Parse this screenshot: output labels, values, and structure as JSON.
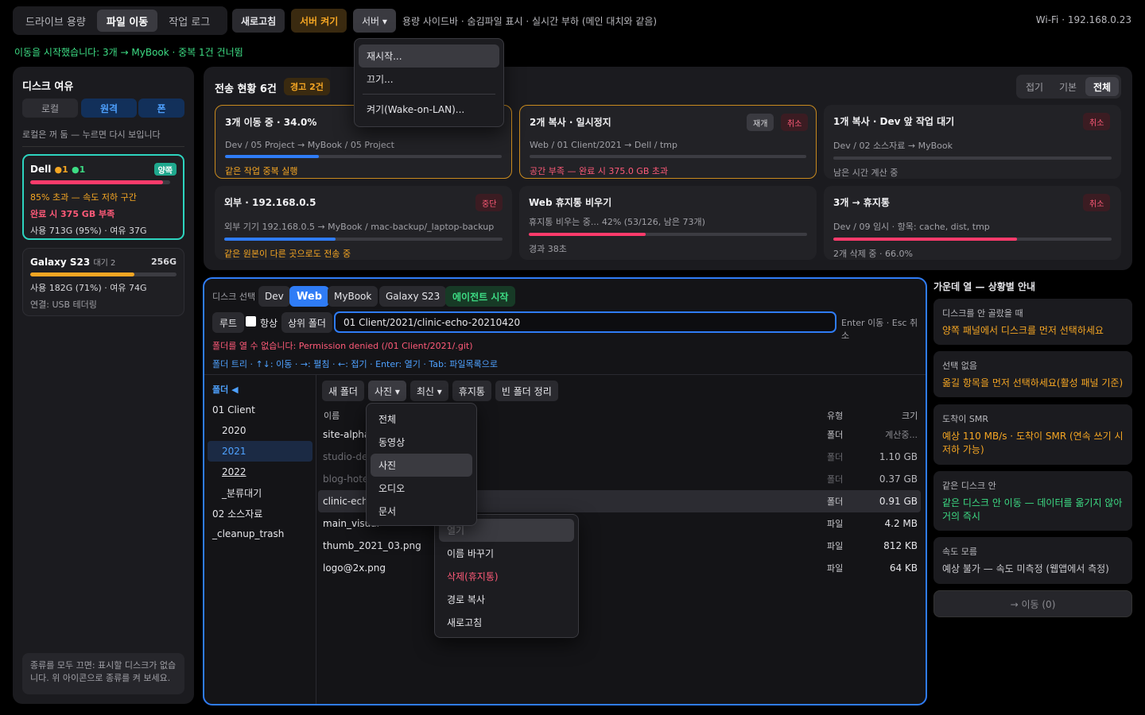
{
  "top": {
    "tabs": [
      "드라이브 용량",
      "파일 이동",
      "작업 로그"
    ],
    "refresh": "새로고침",
    "server_on": "서버 켜기",
    "server": "서버 ▾",
    "info": "용량 사이드바 · 숨김파일 표시 · 실시간 부하 (메인 대치와 같음)",
    "wifi": "Wi-Fi · 192.168.0.23",
    "status": "이동을 시작했습니다: 3개 → MyBook · 중복 1건 건너뜀"
  },
  "server_menu": [
    "재시작...",
    "끄기...",
    "켜기(Wake-on-LAN)..."
  ],
  "disk": {
    "title": "디스크 여유",
    "tabs": [
      "로컬",
      "원격",
      "폰"
    ],
    "hint": "로컬은 꺼 둠 — 누르면 다시 보입니다",
    "dell": {
      "name": "Dell",
      "a": "●1",
      "b": "●1",
      "badge": "양쪽",
      "w1": "85% 초과 — 속도 저하 구간",
      "w2": "완료 시 375 GB 부족",
      "use": "사용 713G (95%) · 여유 37G",
      "fill": 0.95
    },
    "galaxy": {
      "name": "Galaxy S23",
      "wait": "대기 2",
      "size": "256G",
      "use": "사용 182G (71%) · 여유 74G",
      "conn": "연결: USB 테더링",
      "fill": 0.71
    },
    "foot": "종류를 모두 끄면: 표시할 디스크가 없습니다. 위 아이콘으로 종류를 켜 보세요."
  },
  "transfer": {
    "title": "전송 현황 6건",
    "warn": "경고 2건",
    "views": [
      "접기",
      "기본",
      "전체"
    ],
    "cards": [
      {
        "t": "3개 이동 중 · 34.0%",
        "s": "Dev / 05 Project → MyBook / 05 Project",
        "n": "같은 작업 중복 실행",
        "fill": 0.34
      },
      {
        "t": "2개 복사 · 일시정지",
        "s": "Web / 01 Client/2021 → Dell / tmp",
        "n": "공간 부족 — 완료 시 375.0 GB 초과",
        "b1": "재개",
        "b2": "취소"
      },
      {
        "t": "1개 복사 · Dev 앞 작업 대기",
        "s": "Dev / 02 소스자료 → MyBook",
        "n": "남은 시간 계산 중",
        "b2": "취소"
      },
      {
        "t": "외부 · 192.168.0.5",
        "s": "외부 기기 192.168.0.5 → MyBook / mac-backup/_laptop-backup",
        "n": "같은 원본이 다른 곳으로도 전송 중",
        "b2": "중단",
        "fill": 0.4
      },
      {
        "t": "Web 휴지통 비우기",
        "s": "휴지통 비우는 중... 42% (53/126, 남은 73개)",
        "n": "경과 38초",
        "fill": 0.42
      },
      {
        "t": "3개 → 휴지통",
        "s": "Dev / 09 임시 · 항목: cache, dist, tmp",
        "n": "2개 삭제 중 · 66.0%",
        "b2": "취소",
        "fill": 0.66
      }
    ]
  },
  "browser": {
    "label": "디스크 선택",
    "disks": [
      "Dev",
      "Web",
      "MyBook",
      "Galaxy S23"
    ],
    "agent": "에이전트 시작",
    "root": "루트",
    "always": "항상",
    "up": "상위 폴더",
    "path": "01 Client/2021/clinic-echo-20210420",
    "keys": "Enter 이동 · Esc 취소",
    "error": "폴더를 열 수 없습니다: Permission denied (/01 Client/2021/.git)",
    "tip": "폴더 트리 · ↑↓: 이동 · →: 펼침 · ←: 접기 · Enter: 열기 · Tab: 파일목록으로",
    "folder_hdr": "폴더 ◀",
    "tree": [
      "01 Client",
      "2020",
      "2021",
      "2022",
      "_분류대기",
      "02 소스자료",
      "_cleanup_trash"
    ],
    "tools": [
      "새 폴더",
      "사진 ▾",
      "최신 ▾",
      "휴지통",
      "빈 폴더 정리"
    ],
    "cols": {
      "name": "이름",
      "type": "유형",
      "size": "크기"
    },
    "rows": [
      {
        "n": "site-alpha",
        "t": "폴더",
        "s": "계산중..."
      },
      {
        "n": "studio-del",
        "t": "폴더",
        "s": "1.10 GB"
      },
      {
        "n": "blog-hotel",
        "t": "폴더",
        "s": "0.37 GB"
      },
      {
        "n": "clinic-echo",
        "t": "폴더",
        "s": "0.91 GB"
      },
      {
        "n": "main_visual",
        "t": "파일",
        "s": "4.2 MB"
      },
      {
        "n": "thumb_2021_03.png",
        "t": "파일",
        "s": "812 KB"
      },
      {
        "n": "logo@2x.png",
        "t": "파일",
        "s": "64 KB"
      }
    ],
    "filter_menu": [
      "전체",
      "동영상",
      "사진",
      "오디오",
      "문서"
    ],
    "ctx_menu": [
      "열기",
      "이름 바꾸기",
      "삭제(휴지통)",
      "경로 복사",
      "새로고침"
    ]
  },
  "help": {
    "title": "가운데 열 — 상황별 안내",
    "cards": [
      {
        "h": "디스크를 안 골랐을 때",
        "b": "양쪽 패널에서 디스크를 먼저 선택하세요",
        "c": "#f5a623"
      },
      {
        "h": "선택 없음",
        "b": "옮길 항목을 먼저 선택하세요(활성 패널 기준)",
        "c": "#f5a623"
      },
      {
        "h": "도착이 SMR",
        "b": "예상 110 MB/s · 도착이 SMR (연속 쓰기 시 저하 가능)",
        "c": "#f5a623"
      },
      {
        "h": "같은 디스크 안",
        "b": "같은 디스크 안 이동 — 데이터를 옮기지 않아 거의 즉시",
        "c": "#3ddc84"
      },
      {
        "h": "속도 모름",
        "b": "예상 불가 — 속도 미측정 (웹앱에서 측정)",
        "c": "#c8c8cc"
      }
    ],
    "move": "→ 이동 (0)"
  }
}
